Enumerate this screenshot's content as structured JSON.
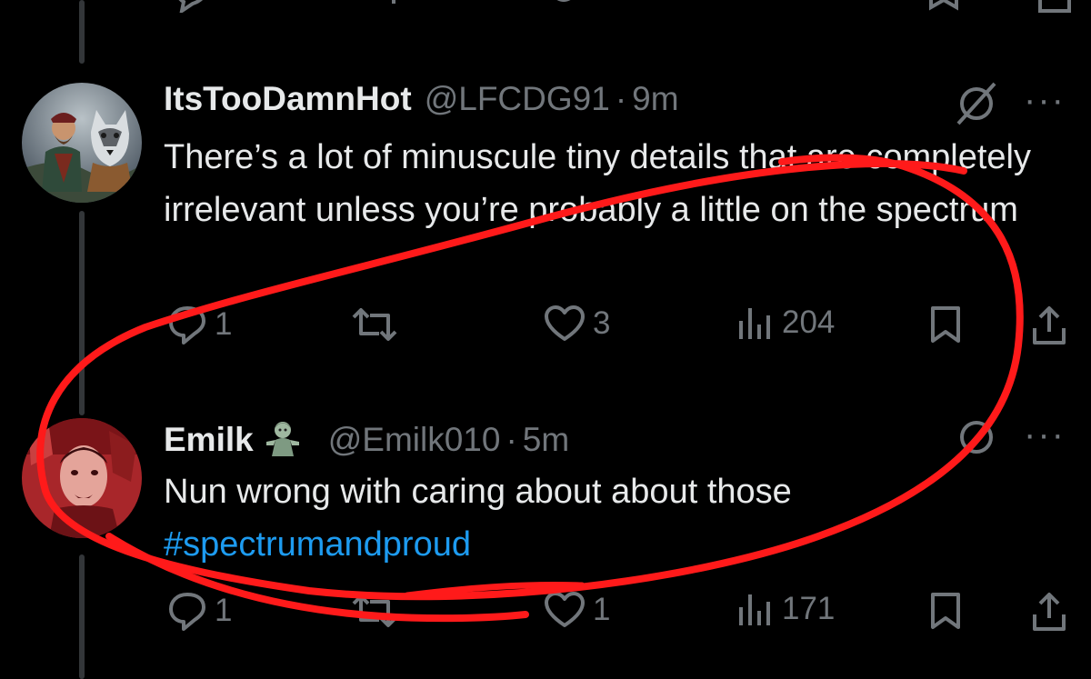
{
  "tweets": [
    {
      "name": "ItsTooDamnHot",
      "handle": "@LFCDG91",
      "separator": "·",
      "time": "9m",
      "text": "There’s a lot of minuscule tiny details that are completely irrelevant unless you’re probably a little on the spectrum",
      "hashtag": "",
      "replies": "1",
      "reposts": "",
      "likes": "3",
      "views": "204",
      "avatar_icon": "man-with-husky-avatar",
      "more_label": "···"
    },
    {
      "name": "Emilk",
      "handle": "@Emilk010",
      "separator": "·",
      "time": "5m",
      "text": "Nun wrong with caring about about those",
      "hashtag": "#spectrumandproud",
      "replies": "1",
      "reposts": "",
      "likes": "1",
      "views": "171",
      "avatar_icon": "red-tinted-man-avatar",
      "badge_icon": "zombie-emoji",
      "more_label": "···"
    }
  ],
  "colors": {
    "background": "#000000",
    "text_primary": "#e7e9ea",
    "text_secondary": "#71767b",
    "link": "#1d9bf0",
    "scribble": "#ff1a1a"
  }
}
